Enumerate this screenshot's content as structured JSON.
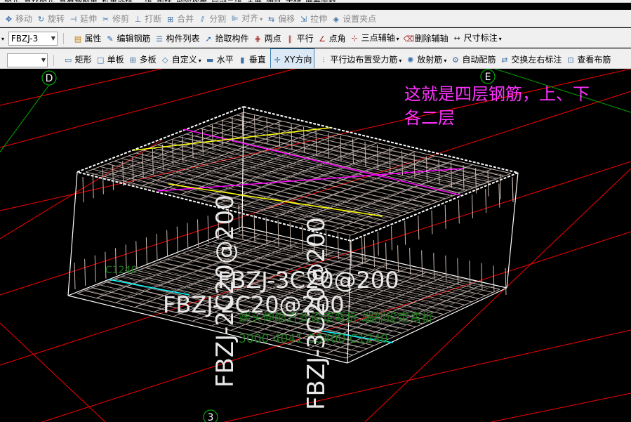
{
  "toolbar_top": {
    "items": [
      "图元",
      "查找图元",
      "查看钢筋量",
      "批量选择",
      "二维",
      "俯视",
      "动态观察",
      "局部三维",
      "全屏",
      "缩放",
      "平移",
      "屏幕旋转"
    ]
  },
  "toolbar_edit": {
    "items": [
      {
        "icon": "move-icon",
        "label": "移动"
      },
      {
        "icon": "rotate-icon",
        "label": "旋转"
      },
      {
        "icon": "extend-icon",
        "label": "延伸"
      },
      {
        "icon": "trim-icon",
        "label": "修剪"
      },
      {
        "icon": "break-icon",
        "label": "打断"
      },
      {
        "icon": "merge-icon",
        "label": "合并"
      },
      {
        "icon": "split-icon",
        "label": "分割"
      },
      {
        "icon": "align-icon",
        "label": "对齐"
      },
      {
        "icon": "offset-icon",
        "label": "偏移"
      },
      {
        "icon": "stretch-icon",
        "label": "拉伸"
      },
      {
        "icon": "set-grip-icon",
        "label": "设置夹点"
      }
    ]
  },
  "toolbar_props": {
    "component_select": "FBZJ-3",
    "items": [
      {
        "icon": "properties-icon",
        "label": "属性"
      },
      {
        "icon": "edit-rebar-icon",
        "label": "编辑钢筋"
      },
      {
        "icon": "component-list-icon",
        "label": "构件列表"
      },
      {
        "icon": "pick-component-icon",
        "label": "拾取构件"
      },
      {
        "icon": "two-points-icon",
        "label": "两点"
      },
      {
        "icon": "parallel-icon",
        "label": "平行"
      },
      {
        "icon": "point-angle-icon",
        "label": "点角"
      },
      {
        "icon": "three-point-axis-icon",
        "label": "三点辅轴"
      },
      {
        "icon": "delete-axis-icon",
        "label": "删除辅轴"
      },
      {
        "icon": "dimension-icon",
        "label": "尺寸标注"
      }
    ]
  },
  "toolbar_draw": {
    "items": [
      {
        "icon": "rectangle-icon",
        "label": "矩形"
      },
      {
        "icon": "single-slab-icon",
        "label": "单板"
      },
      {
        "icon": "multi-slab-icon",
        "label": "多板"
      },
      {
        "icon": "custom-icon",
        "label": "自定义"
      },
      {
        "icon": "horizontal-icon",
        "label": "水平"
      },
      {
        "icon": "vertical-icon",
        "label": "垂直"
      },
      {
        "icon": "xy-direction-icon",
        "label": "XY方向"
      },
      {
        "icon": "parallel-edge-icon",
        "label": "平行边布置受力筋"
      },
      {
        "icon": "radial-icon",
        "label": "放射筋"
      },
      {
        "icon": "auto-rebar-icon",
        "label": "自动配筋"
      },
      {
        "icon": "swap-label-icon",
        "label": "交换左右标注"
      },
      {
        "icon": "view-layout-icon",
        "label": "查看布筋"
      }
    ]
  },
  "viewport": {
    "note_line1": "这就是四层钢筋，上、下",
    "note_line2": "各二层",
    "axis_labels": {
      "d": "D",
      "e": "E",
      "three": "3"
    },
    "rebar_labels": {
      "top1": "FBZJ-3C20@200",
      "top2": "FBZJ-2C20@200",
      "vert1": "FBZJ-2C20@200",
      "vert2": "FBZJ-3C20@200",
      "green1": "C1240",
      "green2": "端头伸缩方式设定弯折  端部设定弯折",
      "green3": "3000 4041   C3400   C1240"
    },
    "colors": {
      "grid": "#ff0000",
      "green_axis": "#00aa00",
      "box": "#ffffff",
      "mesh": "#cbbcb5",
      "magenta": "#ff00ff",
      "yellow": "#ffff00",
      "cyan": "#00ffff",
      "note": "#ff33ff",
      "green_text": "#1a7a1a"
    }
  }
}
